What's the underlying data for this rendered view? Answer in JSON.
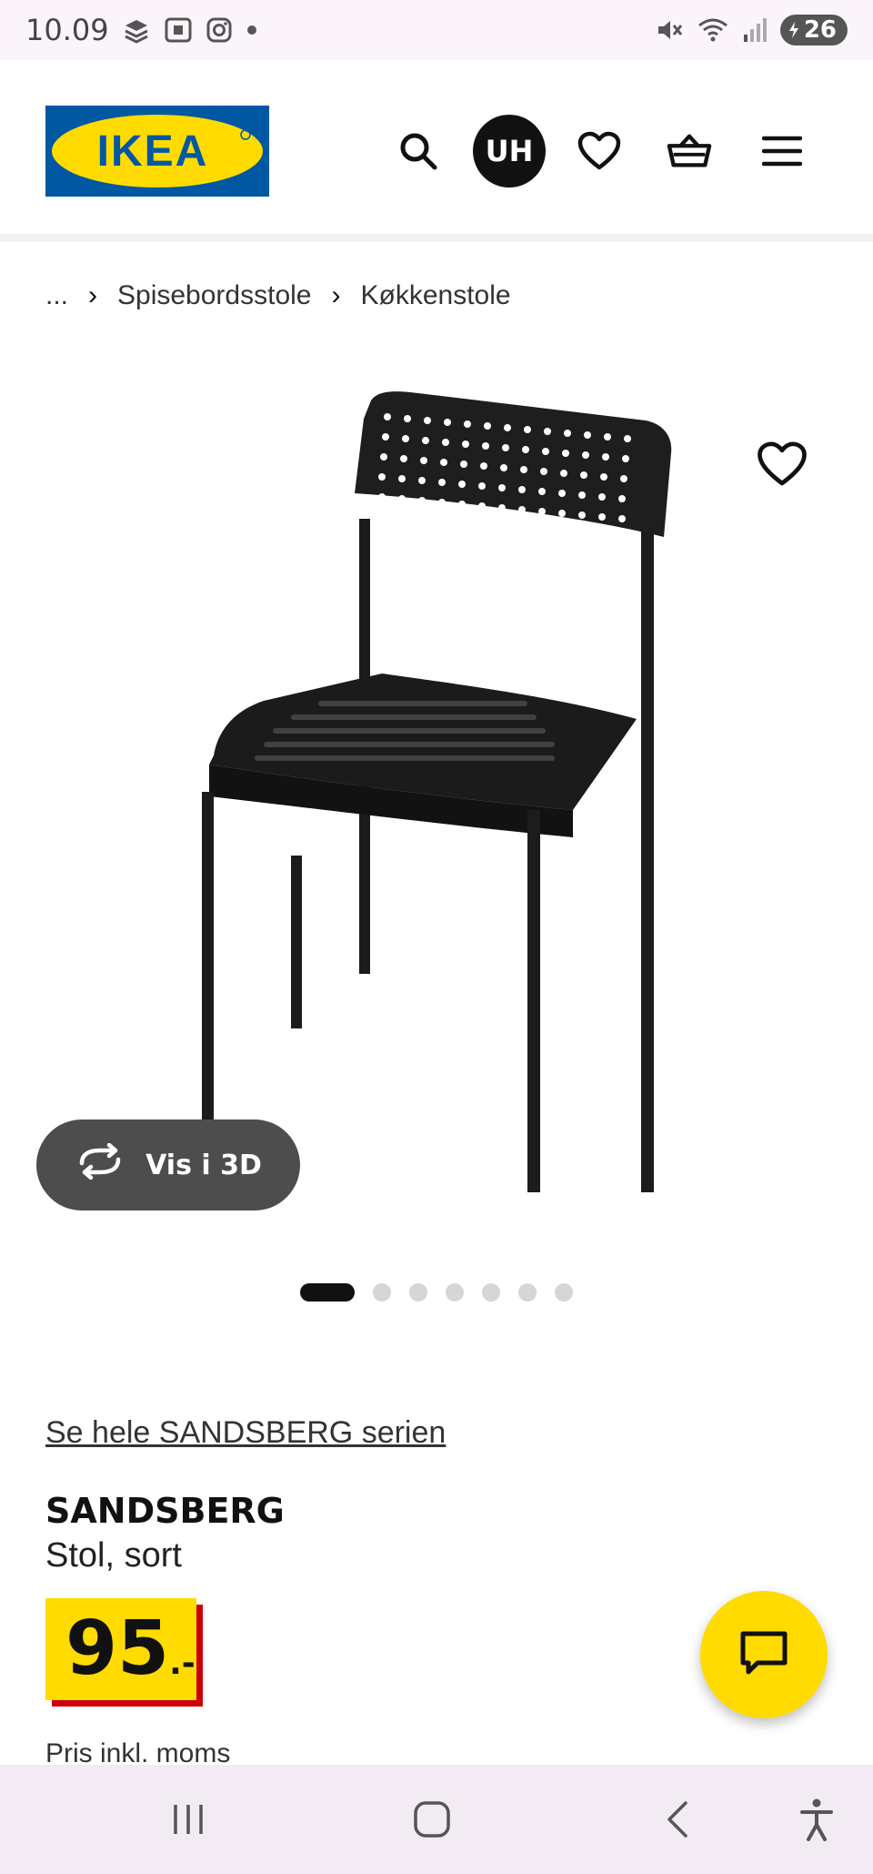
{
  "status_bar": {
    "time": "10.09",
    "battery": "26",
    "icons": [
      "notification-stack-icon",
      "screenshot-icon",
      "instagram-icon",
      "dot-icon",
      "mute-icon",
      "wifi-icon",
      "signal-icon",
      "battery-icon"
    ]
  },
  "header": {
    "logo_text": "IKEA",
    "logo_colors": {
      "blue": "#0058a3",
      "yellow": "#ffdb00"
    },
    "avatar_initials": "UH",
    "icons": [
      "search-icon",
      "heart-icon",
      "basket-icon",
      "menu-icon"
    ]
  },
  "breadcrumb": {
    "items": [
      "...",
      "Spisebordsstole",
      "Køkkenstole"
    ]
  },
  "product": {
    "image_icon": "chair-image",
    "view_3d_label": "Vis i 3D",
    "gallery": {
      "count": 7,
      "active_index": 0
    },
    "series_link": "Se hele SANDSBERG serien",
    "name": "SANDSBERG",
    "description": "Stol, sort",
    "price": "95",
    "price_suffix": ".-",
    "vat_note": "Pris inkl. moms"
  },
  "colors": {
    "price_yellow": "#ffdb00",
    "price_shadow_red": "#cc0008",
    "chat_yellow": "#ffdb00"
  },
  "nav_bar": {
    "icons": [
      "recents-icon",
      "home-icon",
      "back-icon",
      "accessibility-icon"
    ]
  }
}
